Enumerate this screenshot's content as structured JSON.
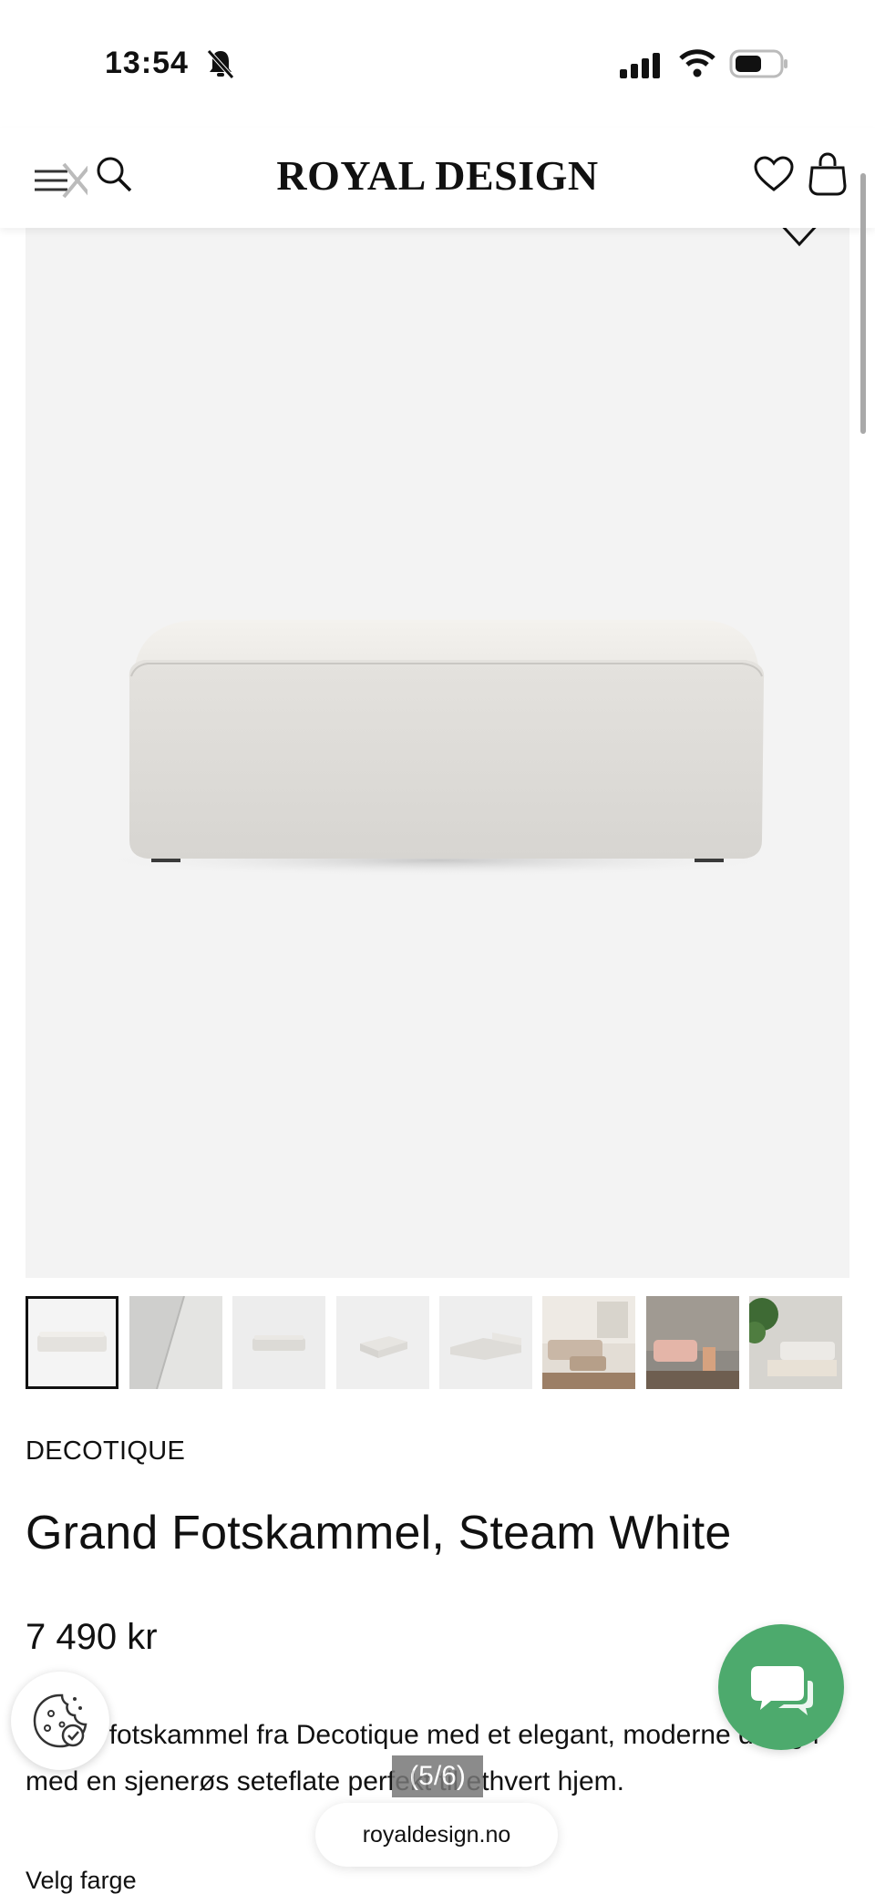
{
  "status_bar": {
    "time": "13:54"
  },
  "header": {
    "logo": "ROYAL DESIGN",
    "icons": [
      "menu-icon",
      "close-icon",
      "search-icon",
      "heart-icon",
      "shopping-bag-icon"
    ]
  },
  "gallery": {
    "thumbnail_count": 8,
    "active_index": 0,
    "counter": "(5/6)"
  },
  "product": {
    "brand": "DECOTIQUE",
    "title": "Grand Fotskammel, Steam White",
    "price": "7 490 kr",
    "description": "Grand fotskammel fra Decotique med et elegant, moderne design med en sjenerøs seteflate perfekt til ethvert hjem.",
    "choose_color_label": "Velg farge"
  },
  "browser": {
    "url": "royaldesign.no"
  },
  "colors": {
    "chat_green": "#4daa6d",
    "image_bg": "#f3f3f3"
  }
}
